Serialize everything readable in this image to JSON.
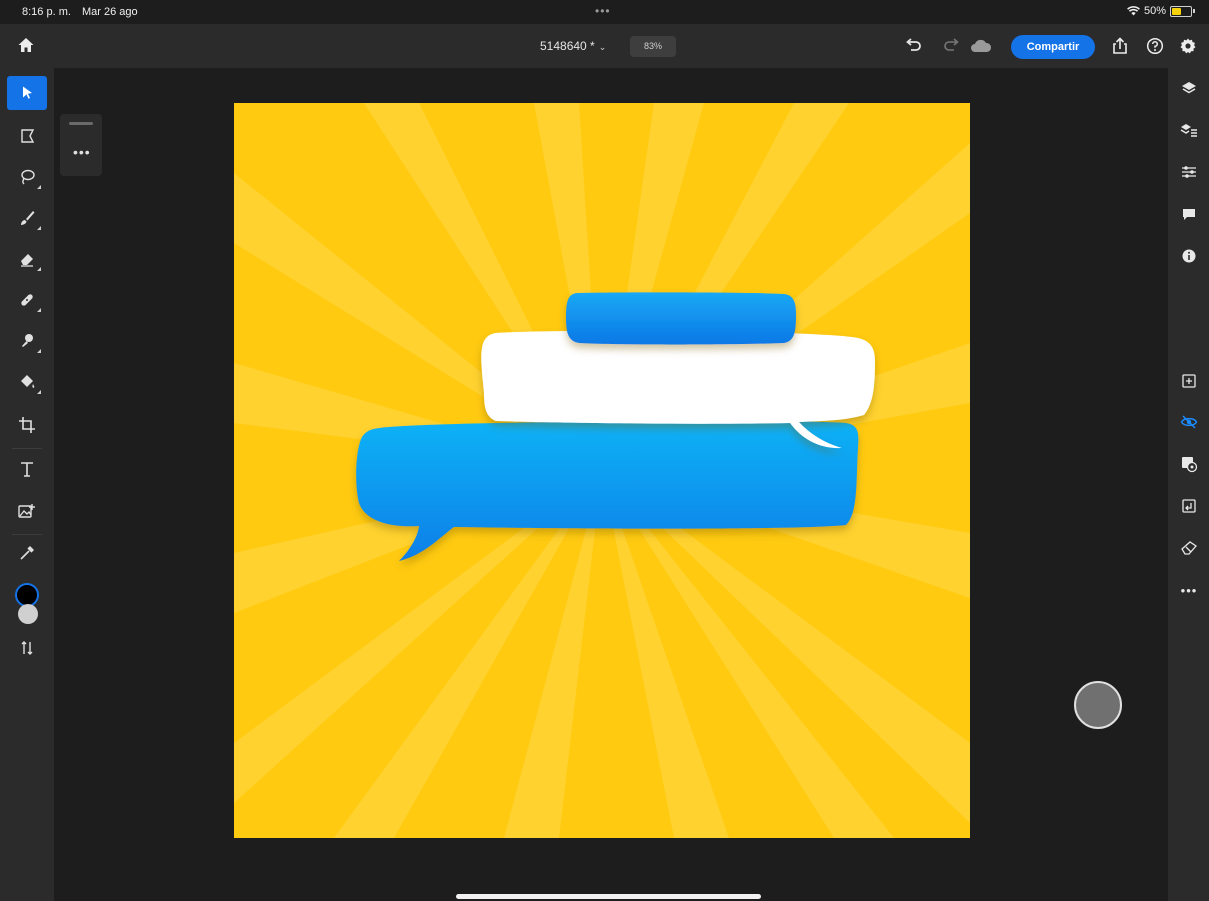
{
  "status_bar": {
    "time": "8:16 p. m.",
    "date": "Mar 26 ago",
    "battery": "50%",
    "battery_level": 0.5
  },
  "top_bar": {
    "document_title": "5148640 *",
    "zoom": "83%",
    "share_label": "Compartir",
    "icons": [
      "home-icon",
      "undo-icon",
      "redo-icon",
      "cloud-icon",
      "share-export-icon",
      "help-icon",
      "settings-icon"
    ]
  },
  "left_toolbar": {
    "tools": [
      "move-tool",
      "transform-tool",
      "lasso-tool",
      "brush-tool",
      "eraser-tool",
      "healing-tool",
      "clone-stamp-tool",
      "paint-bucket-tool",
      "crop-tool",
      "type-tool",
      "place-image-tool",
      "eyedropper-tool"
    ],
    "active_tool": "move-tool",
    "foreground_color": "#000000",
    "background_color": "#d0d0d0"
  },
  "right_toolbar": {
    "icons": [
      "layers-icon",
      "layer-properties-icon",
      "adjustments-icon",
      "comments-icon",
      "info-icon",
      "add-layer-icon",
      "visibility-icon",
      "mask-icon",
      "layer-arrange-icon",
      "eraser-layer-icon",
      "more-icon"
    ]
  },
  "colors": {
    "accent": "#1473e6",
    "canvas_yellow": "#ffcb0f",
    "bubble_blue": "#0a90ec",
    "bubble_white": "#ffffff"
  }
}
